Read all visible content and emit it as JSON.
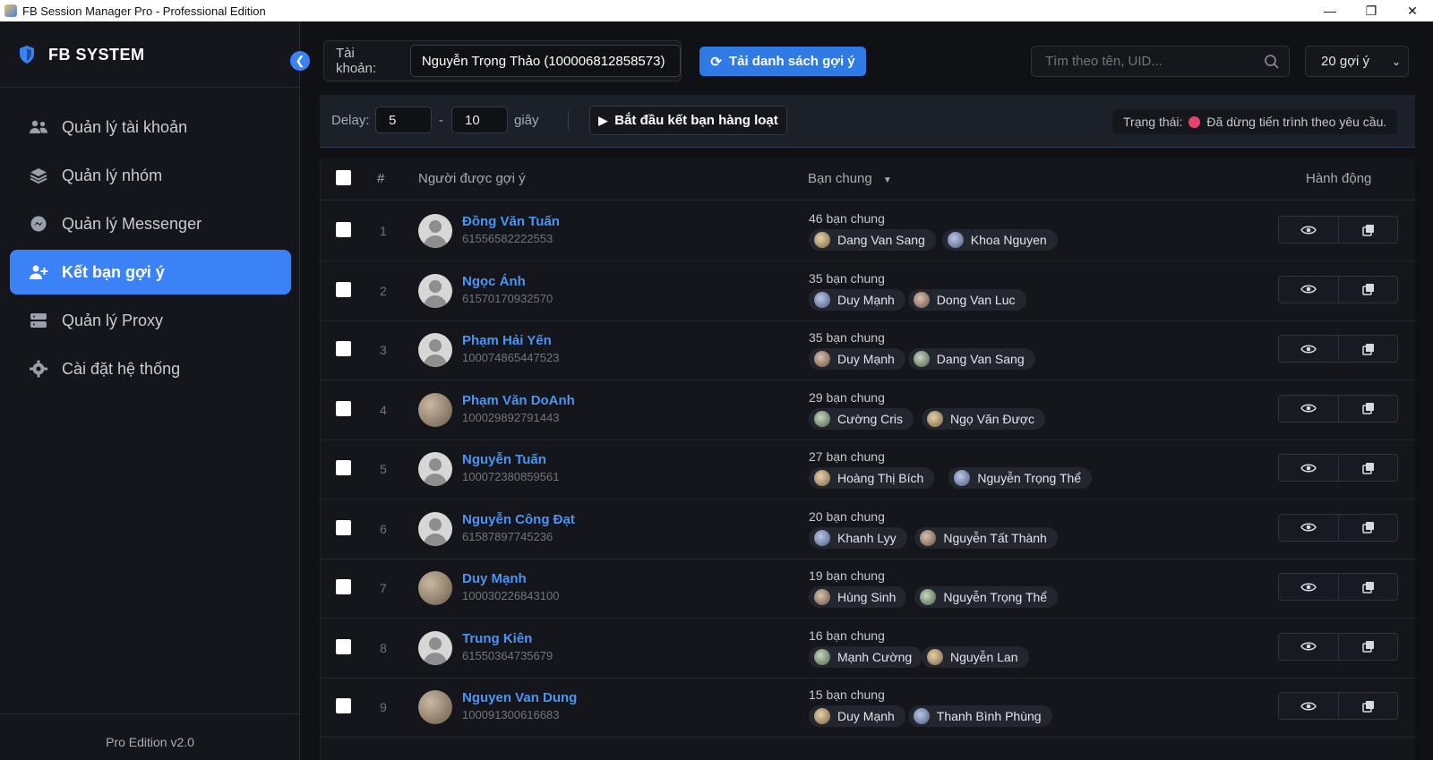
{
  "window": {
    "title": "FB Session Manager Pro - Professional Edition"
  },
  "sidebar": {
    "brand": "FB SYSTEM",
    "items": [
      {
        "label": "Quản lý tài khoản",
        "icon": "users-icon"
      },
      {
        "label": "Quản lý nhóm",
        "icon": "layers-icon"
      },
      {
        "label": "Quản lý Messenger",
        "icon": "messenger-icon"
      },
      {
        "label": "Kết bạn gợi ý",
        "icon": "user-plus-icon",
        "active": true
      },
      {
        "label": "Quản lý Proxy",
        "icon": "server-icon"
      },
      {
        "label": "Cài đặt hệ thống",
        "icon": "gear-icon"
      }
    ],
    "version": "Pro Edition v2.0"
  },
  "topbar": {
    "account_label": "Tài khoản:",
    "account_value": "Nguyễn Trọng Thảo (100006812858573)",
    "load_button": "Tải danh sách gợi ý",
    "search_placeholder": "Tìm theo tên, UID...",
    "per_page": "20 gợi ý"
  },
  "controls": {
    "delay_label": "Delay:",
    "delay_min": "5",
    "dash": "-",
    "delay_max": "10",
    "unit": "giây",
    "start_button": "Bắt đầu kết bạn hàng loạt",
    "status_label": "Trạng thái:",
    "status_text": "Đã dừng tiến trình theo yêu cầu.",
    "status_color": "#e8436c"
  },
  "table": {
    "headers": {
      "index": "#",
      "person": "Người được gợi ý",
      "mutual": "Bạn chung",
      "sort_icon": "▼",
      "actions": "Hành động"
    },
    "rows": [
      {
        "idx": "1",
        "name": "Đồng Văn Tuấn",
        "uid": "61556582222553",
        "mutual": "46 bạn chung",
        "friends": [
          "Dang Van Sang",
          "Khoa Nguyen"
        ],
        "photo": false
      },
      {
        "idx": "2",
        "name": "Ngọc Ánh",
        "uid": "61570170932570",
        "mutual": "35 bạn chung",
        "friends": [
          "Duy Mạnh",
          "Dong Van Luc"
        ],
        "photo": false
      },
      {
        "idx": "3",
        "name": "Phạm Hải Yến",
        "uid": "100074865447523",
        "mutual": "35 bạn chung",
        "friends": [
          "Duy Mạnh",
          "Dang Van Sang"
        ],
        "photo": false
      },
      {
        "idx": "4",
        "name": "Phạm Văn DoAnh",
        "uid": "100029892791443",
        "mutual": "29 bạn chung",
        "friends": [
          "Cường Cris",
          "Ngọ Văn Được"
        ],
        "photo": true
      },
      {
        "idx": "5",
        "name": "Nguyễn Tuấn",
        "uid": "100072380859561",
        "mutual": "27 bạn chung",
        "friends": [
          "Hoàng Thị Bích",
          "Nguyễn Trọng Thể"
        ],
        "photo": false
      },
      {
        "idx": "6",
        "name": "Nguyễn Công Đạt",
        "uid": "61587897745236",
        "mutual": "20 bạn chung",
        "friends": [
          "Khanh Lyy",
          "Nguyễn Tất Thành"
        ],
        "photo": false
      },
      {
        "idx": "7",
        "name": "Duy Mạnh",
        "uid": "100030226843100",
        "mutual": "19 bạn chung",
        "friends": [
          "Hùng Sinh",
          "Nguyễn Trọng Thể"
        ],
        "photo": true
      },
      {
        "idx": "8",
        "name": "Trung Kiên",
        "uid": "61550364735679",
        "mutual": "16 bạn chung",
        "friends": [
          "Mạnh Cường",
          "Nguyễn Lan"
        ],
        "photo": false
      },
      {
        "idx": "9",
        "name": "Nguyen Van Dung",
        "uid": "100091300616683",
        "mutual": "15 bạn chung",
        "friends": [
          "Duy Mạnh",
          "Thanh Bình Phùng"
        ],
        "photo": true
      }
    ]
  }
}
